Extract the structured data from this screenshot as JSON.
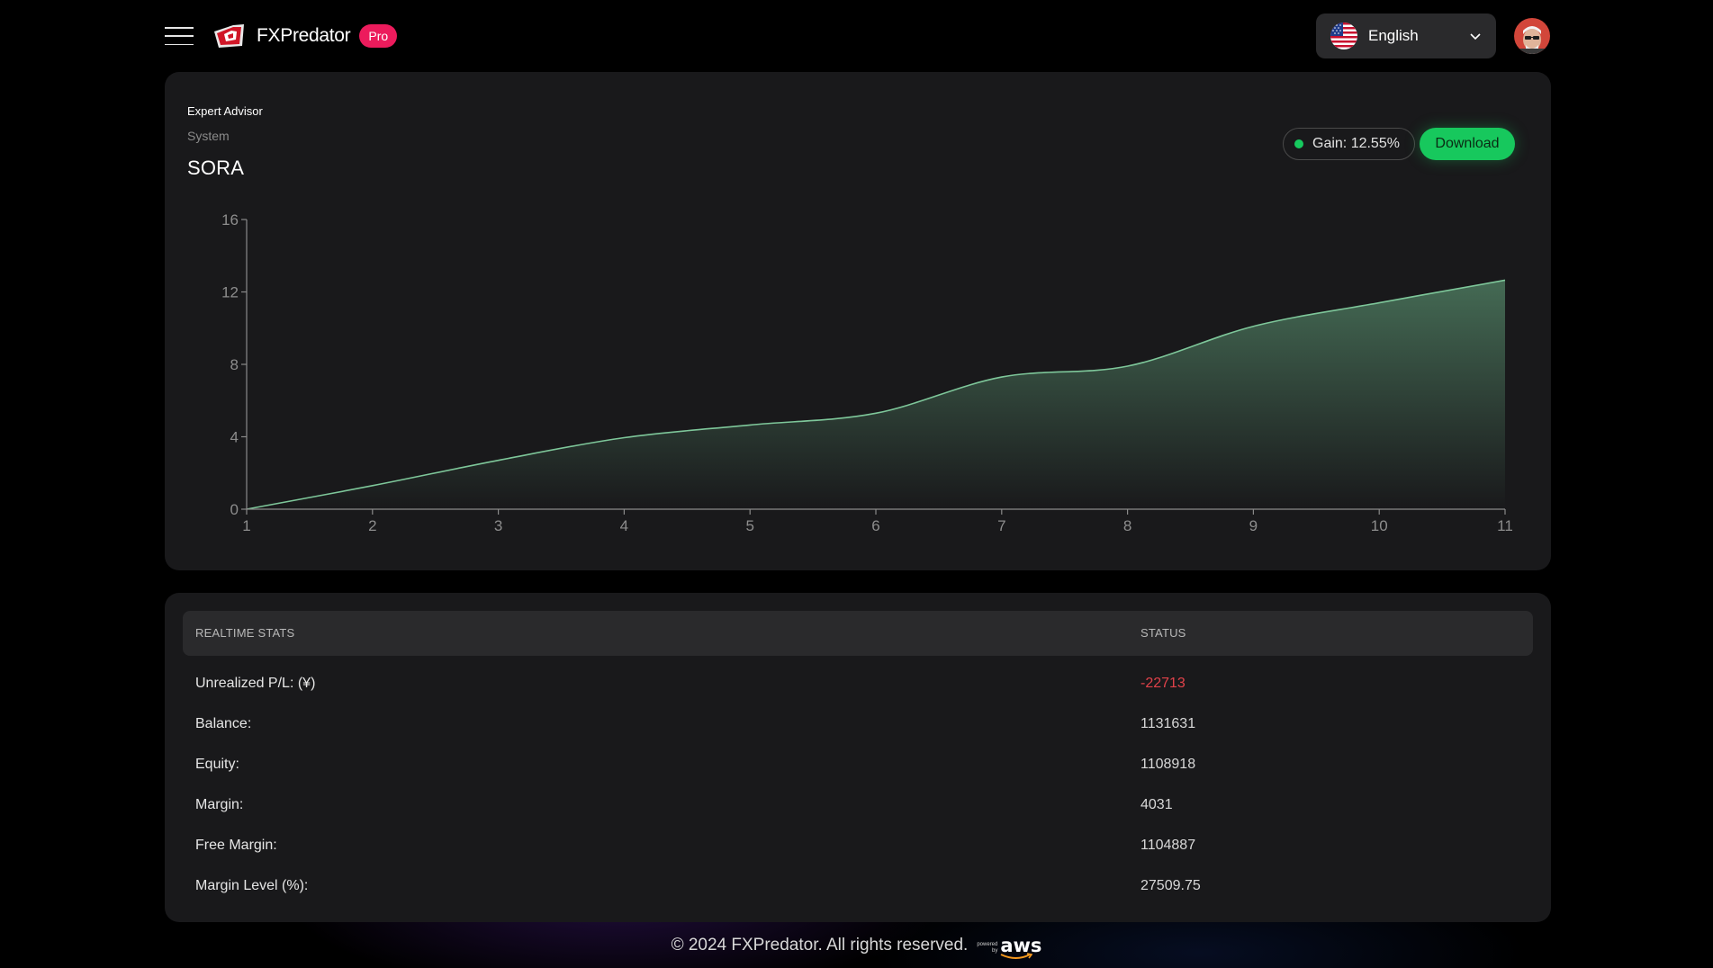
{
  "header": {
    "brand": "FXPredator",
    "badge": "Pro",
    "language": "English"
  },
  "advisor": {
    "eyebrow": "Expert Advisor",
    "sublabel": "System",
    "title": "SORA",
    "gain": "Gain: 12.55%",
    "download_label": "Download"
  },
  "colors": {
    "accent_green": "#17c85d",
    "line_green": "#7ec79a",
    "pro_pink": "#ec1b5c",
    "negative_red": "#e0424a"
  },
  "chart_data": {
    "type": "area",
    "x": [
      1,
      2,
      3,
      4,
      5,
      6,
      7,
      8,
      9,
      10,
      11
    ],
    "values": [
      0,
      1.3,
      2.7,
      3.95,
      4.65,
      5.3,
      7.3,
      7.9,
      10.1,
      11.4,
      12.65
    ],
    "xlim": [
      1,
      11
    ],
    "ylim": [
      0,
      16
    ],
    "yticks": [
      0,
      4,
      8,
      12,
      16
    ],
    "xticks": [
      1,
      2,
      3,
      4,
      5,
      6,
      7,
      8,
      9,
      10,
      11
    ],
    "grid": false,
    "title": "",
    "xlabel": "",
    "ylabel": ""
  },
  "stats": {
    "header_label": "REALTIME STATS",
    "header_status": "STATUS",
    "rows": [
      {
        "label": "Unrealized P/L: (¥)",
        "value": "-22713"
      },
      {
        "label": "Balance:",
        "value": "1131631"
      },
      {
        "label": "Equity:",
        "value": "1108918"
      },
      {
        "label": "Margin:",
        "value": "4031"
      },
      {
        "label": "Free Margin:",
        "value": "1104887"
      },
      {
        "label": "Margin Level (%):",
        "value": "27509.75"
      }
    ]
  },
  "footer": {
    "copyright": "© 2024 FXPredator. All rights reserved.",
    "powered_small_1": "powered",
    "powered_small_2": "by",
    "aws": "aws"
  }
}
